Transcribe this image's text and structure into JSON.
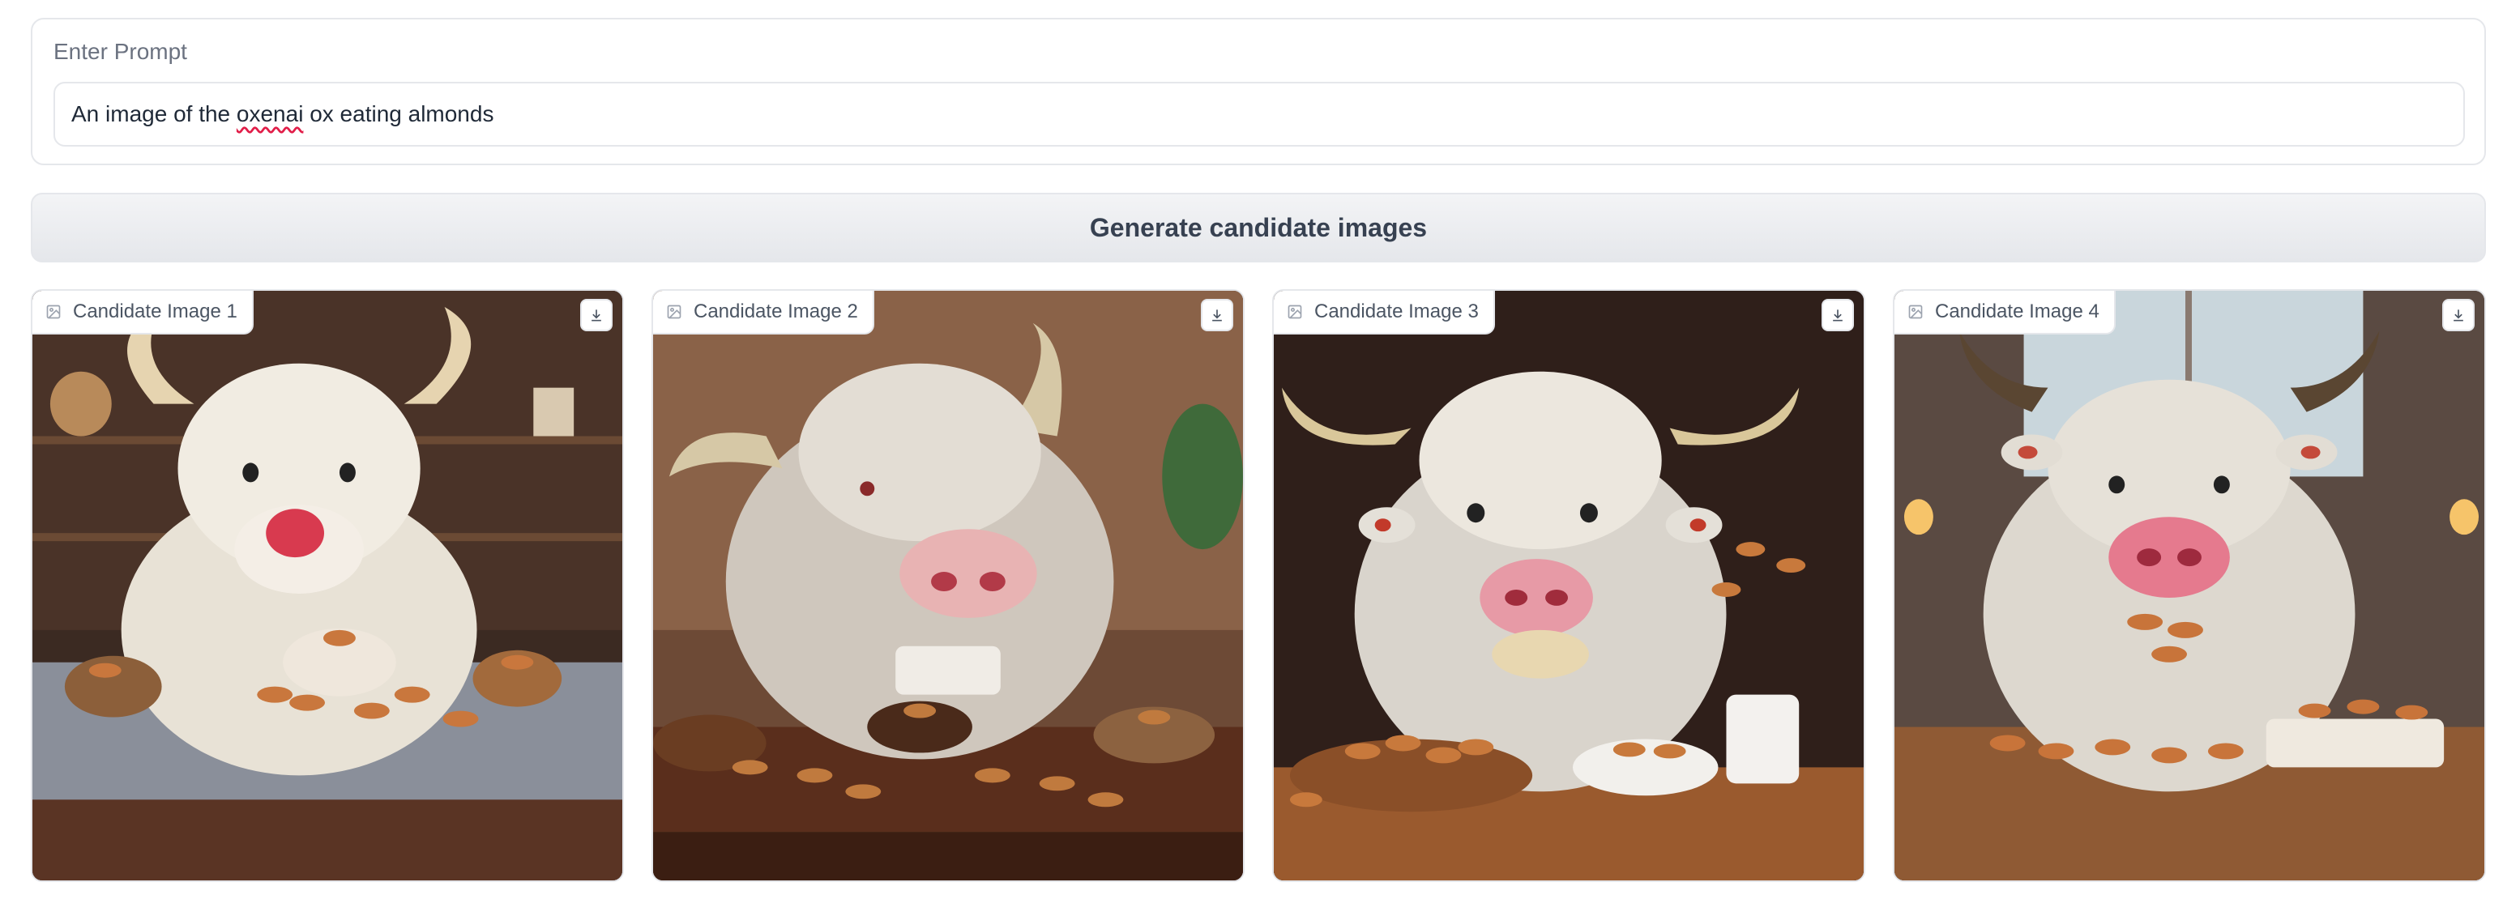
{
  "prompt": {
    "label": "Enter Prompt",
    "value_before": "An image of the ",
    "value_misspelled": "oxenai",
    "value_after": " ox eating almonds"
  },
  "generate_button": {
    "label": "Generate candidate images"
  },
  "candidates": [
    {
      "label": "Candidate Image 1",
      "icon": "image-icon",
      "action_icon": "download-icon"
    },
    {
      "label": "Candidate Image 2",
      "icon": "image-icon",
      "action_icon": "download-icon"
    },
    {
      "label": "Candidate Image 3",
      "icon": "image-icon",
      "action_icon": "download-icon"
    },
    {
      "label": "Candidate Image 4",
      "icon": "image-icon",
      "action_icon": "download-icon"
    }
  ],
  "colors": {
    "border": "#e5e7eb",
    "label_text": "#6b7280",
    "button_bg": "#eef0f3",
    "spellcheck": "#e11d48"
  }
}
